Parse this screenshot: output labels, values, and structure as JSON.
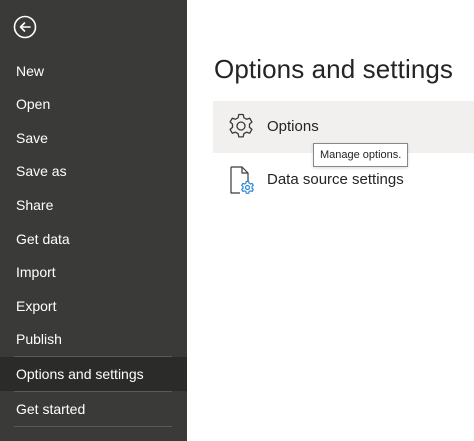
{
  "sidebar": {
    "back_icon": "back-arrow-circle-icon",
    "items": [
      {
        "label": "New"
      },
      {
        "label": "Open"
      },
      {
        "label": "Save"
      },
      {
        "label": "Save as"
      },
      {
        "label": "Share"
      },
      {
        "label": "Get data"
      },
      {
        "label": "Import"
      },
      {
        "label": "Export"
      },
      {
        "label": "Publish"
      },
      {
        "label": "Options and settings",
        "active": true
      },
      {
        "label": "Get started"
      }
    ],
    "bg_color": "#3a3a38",
    "active_color": "#2b2b29"
  },
  "main": {
    "title": "Options and settings",
    "options": [
      {
        "label": "Options",
        "icon": "gear-icon"
      },
      {
        "label": "Data source settings",
        "icon": "document-gear-icon"
      }
    ],
    "tooltip": "Manage options."
  }
}
